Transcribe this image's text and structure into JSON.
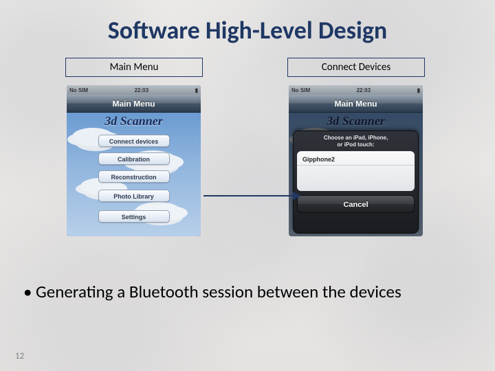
{
  "title": "Software High-Level Design",
  "labels": {
    "left": "Main Menu",
    "right": "Connect Devices"
  },
  "phone": {
    "status": {
      "left": "No SIM",
      "time": "22:03"
    },
    "navTitle": "Main Menu",
    "appTitle": "3d Scanner",
    "menu": [
      "Connect devices",
      "Calibration",
      "Reconstruction",
      "Photo Library",
      "Settings"
    ],
    "sheet": {
      "titleLine1": "Choose an iPad, iPhone,",
      "titleLine2": "or iPod touch:",
      "item": "Gipphone2",
      "cancel": "Cancel"
    }
  },
  "bullet": "Generating a Bluetooth session between the devices",
  "pageNumber": "12"
}
